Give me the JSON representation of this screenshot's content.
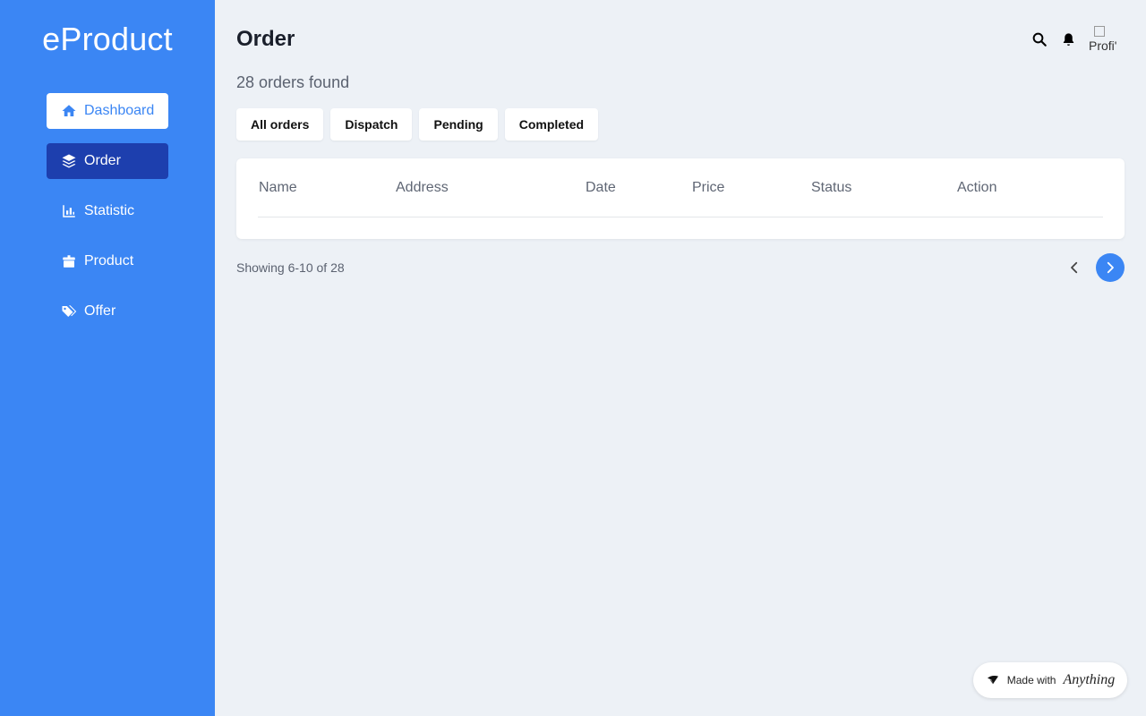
{
  "app": {
    "brand": "eProduct"
  },
  "sidebar": {
    "items": [
      {
        "label": "Dashboard",
        "icon": "home-icon"
      },
      {
        "label": "Order",
        "icon": "layers-icon"
      },
      {
        "label": "Statistic",
        "icon": "bar-chart-icon"
      },
      {
        "label": "Product",
        "icon": "box-icon"
      },
      {
        "label": "Offer",
        "icon": "tags-icon"
      }
    ]
  },
  "header": {
    "title": "Order",
    "avatar_alt": "Profi'"
  },
  "orders": {
    "count_text": "28 orders found",
    "filters": [
      "All orders",
      "Dispatch",
      "Pending",
      "Completed"
    ],
    "columns": [
      "Name",
      "Address",
      "Date",
      "Price",
      "Status",
      "Action"
    ],
    "rows": []
  },
  "pagination": {
    "showing": "Showing 6-10 of 28"
  },
  "badge": {
    "prefix": "Made with",
    "brand": "Anything"
  },
  "colors": {
    "sidebar": "#3b86f4",
    "active_nav": "#1d3fae",
    "background": "#edf1f6",
    "accent": "#3b86f4"
  }
}
